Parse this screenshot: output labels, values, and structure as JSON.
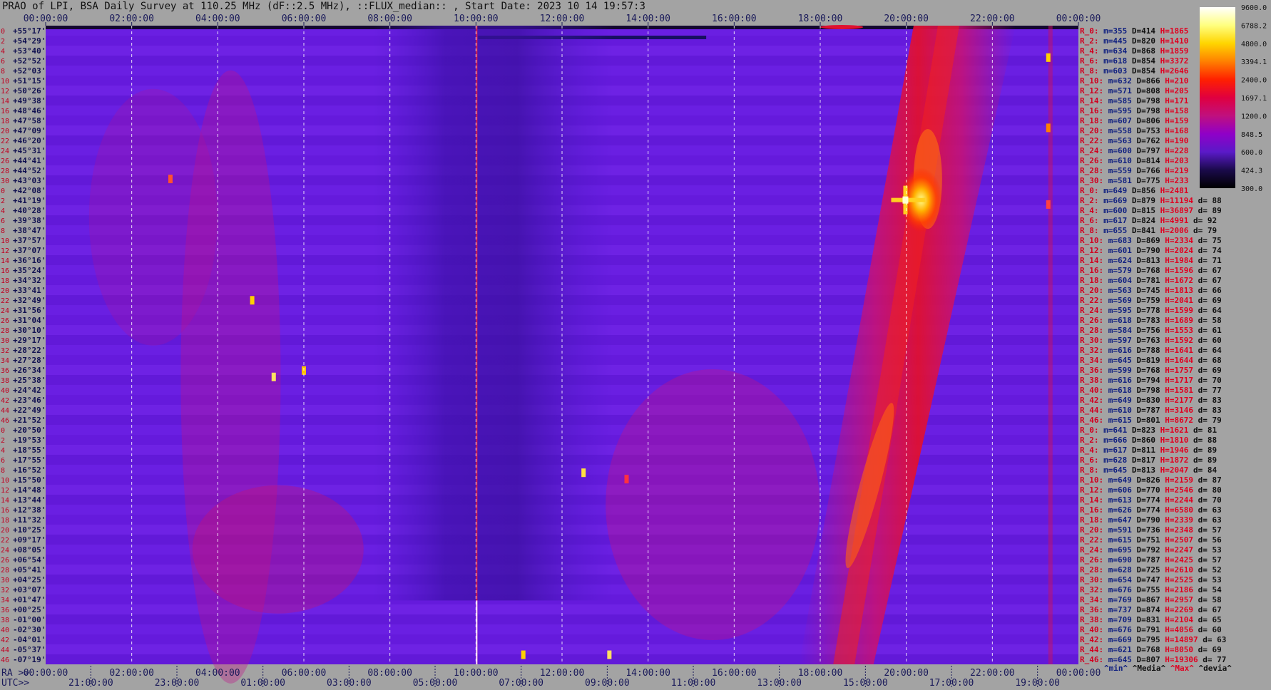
{
  "title": "PRAO of LPI, BSA Daily Survey at 110.25 MHz (dF::2.5 MHz), ::FLUX_median:: , Start Date: 2023 10 14 19:57:3",
  "chart_data": {
    "type": "heatmap",
    "top_time_ticks": [
      "00:00:00",
      "02:00:00",
      "04:00:00",
      "06:00:00",
      "08:00:00",
      "10:00:00",
      "12:00:00",
      "14:00:00",
      "16:00:00",
      "18:00:00",
      "20:00:00",
      "22:00:00",
      "00:00:00"
    ],
    "bottom_ra_ticks": [
      "00:00:00",
      "02:00:00",
      "04:00:00",
      "06:00:00",
      "08:00:00",
      "10:00:00",
      "12:00:00",
      "14:00:00",
      "16:00:00",
      "18:00:00",
      "20:00:00",
      "22:00:00",
      "00:00:00"
    ],
    "bottom_utc_ticks": [
      "21:00:00",
      "23:00:00",
      "01:00:00",
      "03:00:00",
      "05:00:00",
      "07:00:00",
      "09:00:00",
      "11:00:00",
      "13:00:00",
      "15:00:00",
      "17:00:00",
      "19:00:00"
    ],
    "bottom_ra_prefix": "RA >>",
    "bottom_utc_prefix": "UTC>>",
    "declinations": [
      "+55°17'",
      "+54°29'",
      "+53°40'",
      "+52°52'",
      "+52°03'",
      "+51°15'",
      "+50°26'",
      "+49°38'",
      "+48°46'",
      "+47°58'",
      "+47°09'",
      "+46°20'",
      "+45°31'",
      "+44°41'",
      "+44°52'",
      "+43°03'",
      "+42°08'",
      "+41°19'",
      "+40°28'",
      "+39°38'",
      "+38°47'",
      "+37°57'",
      "+37°07'",
      "+36°16'",
      "+35°24'",
      "+34°32'",
      "+33°41'",
      "+32°49'",
      "+31°56'",
      "+31°04'",
      "+30°10'",
      "+29°17'",
      "+28°22'",
      "+27°28'",
      "+26°34'",
      "+25°38'",
      "+24°42'",
      "+23°46'",
      "+22°49'",
      "+21°52'",
      "+20°50'",
      "+19°53'",
      "+18°55'",
      "+17°55'",
      "+16°52'",
      "+15°50'",
      "+14°48'",
      "+13°44'",
      "+12°38'",
      "+11°32'",
      "+10°25'",
      "+09°17'",
      "+08°05'",
      "+06°54'",
      "+05°41'",
      "+04°25'",
      "+03°07'",
      "+01°47'",
      "+00°25'",
      "-01°00'",
      "-02°30'",
      "-04°01'",
      "-05°37'",
      "-07°19'"
    ],
    "row_numbers": [
      "0",
      "2",
      "4",
      "6",
      "8",
      "10",
      "12",
      "14",
      "16",
      "18",
      "20",
      "22",
      "24",
      "26",
      "28",
      "30",
      "0",
      "2",
      "4",
      "6",
      "8",
      "10",
      "12",
      "14",
      "16",
      "18",
      "20",
      "22",
      "24",
      "26",
      "28",
      "30",
      "32",
      "34",
      "36",
      "38",
      "40",
      "42",
      "44",
      "46",
      "0",
      "2",
      "4",
      "6",
      "8",
      "10",
      "12",
      "14",
      "16",
      "18",
      "20",
      "22",
      "24",
      "26",
      "28",
      "30",
      "32",
      "34",
      "36",
      "38",
      "40",
      "42",
      "44",
      "46"
    ],
    "stats": [
      {
        "r": "R_0:",
        "m": "m=355",
        "d": "D=414",
        "h": "H=1865",
        "dv": ""
      },
      {
        "r": "R_2:",
        "m": "m=445",
        "d": "D=820",
        "h": "H=1410",
        "dv": ""
      },
      {
        "r": "R_4:",
        "m": "m=634",
        "d": "D=868",
        "h": "H=1859",
        "dv": ""
      },
      {
        "r": "R_6:",
        "m": "m=618",
        "d": "D=854",
        "h": "H=3372",
        "dv": ""
      },
      {
        "r": "R_8:",
        "m": "m=603",
        "d": "D=854",
        "h": "H=2646",
        "dv": ""
      },
      {
        "r": "R_10:",
        "m": "m=632",
        "d": "D=866",
        "h": "H=210",
        "dv": ""
      },
      {
        "r": "R_12:",
        "m": "m=571",
        "d": "D=808",
        "h": "H=205",
        "dv": ""
      },
      {
        "r": "R_14:",
        "m": "m=585",
        "d": "D=798",
        "h": "H=171",
        "dv": ""
      },
      {
        "r": "R_16:",
        "m": "m=595",
        "d": "D=798",
        "h": "H=158",
        "dv": ""
      },
      {
        "r": "R_18:",
        "m": "m=607",
        "d": "D=806",
        "h": "H=159",
        "dv": ""
      },
      {
        "r": "R_20:",
        "m": "m=558",
        "d": "D=753",
        "h": "H=168",
        "dv": ""
      },
      {
        "r": "R_22:",
        "m": "m=563",
        "d": "D=762",
        "h": "H=190",
        "dv": ""
      },
      {
        "r": "R_24:",
        "m": "m=600",
        "d": "D=797",
        "h": "H=228",
        "dv": ""
      },
      {
        "r": "R_26:",
        "m": "m=610",
        "d": "D=814",
        "h": "H=203",
        "dv": ""
      },
      {
        "r": "R_28:",
        "m": "m=559",
        "d": "D=766",
        "h": "H=219",
        "dv": ""
      },
      {
        "r": "R_30:",
        "m": "m=581",
        "d": "D=775",
        "h": "H=233",
        "dv": ""
      },
      {
        "r": "R_0:",
        "m": "m=649",
        "d": "D=856",
        "h": "H=2481",
        "dv": ""
      },
      {
        "r": "R_2:",
        "m": "m=669",
        "d": "D=879",
        "h": "H=11194",
        "dv": "d= 88"
      },
      {
        "r": "R_4:",
        "m": "m=600",
        "d": "D=815",
        "h": "H=36897",
        "dv": "d= 89"
      },
      {
        "r": "R_6:",
        "m": "m=617",
        "d": "D=824",
        "h": "H=4991",
        "dv": "d= 92"
      },
      {
        "r": "R_8:",
        "m": "m=655",
        "d": "D=841",
        "h": "H=2006",
        "dv": "d= 79"
      },
      {
        "r": "R_10:",
        "m": "m=683",
        "d": "D=869",
        "h": "H=2334",
        "dv": "d= 75"
      },
      {
        "r": "R_12:",
        "m": "m=601",
        "d": "D=790",
        "h": "H=2024",
        "dv": "d= 74"
      },
      {
        "r": "R_14:",
        "m": "m=624",
        "d": "D=813",
        "h": "H=1984",
        "dv": "d= 71"
      },
      {
        "r": "R_16:",
        "m": "m=579",
        "d": "D=768",
        "h": "H=1596",
        "dv": "d= 67"
      },
      {
        "r": "R_18:",
        "m": "m=604",
        "d": "D=781",
        "h": "H=1672",
        "dv": "d= 67"
      },
      {
        "r": "R_20:",
        "m": "m=563",
        "d": "D=745",
        "h": "H=1813",
        "dv": "d= 66"
      },
      {
        "r": "R_22:",
        "m": "m=569",
        "d": "D=759",
        "h": "H=2041",
        "dv": "d= 69"
      },
      {
        "r": "R_24:",
        "m": "m=595",
        "d": "D=778",
        "h": "H=1599",
        "dv": "d= 64"
      },
      {
        "r": "R_26:",
        "m": "m=618",
        "d": "D=783",
        "h": "H=1689",
        "dv": "d= 58"
      },
      {
        "r": "R_28:",
        "m": "m=584",
        "d": "D=756",
        "h": "H=1553",
        "dv": "d= 61"
      },
      {
        "r": "R_30:",
        "m": "m=597",
        "d": "D=763",
        "h": "H=1592",
        "dv": "d= 60"
      },
      {
        "r": "R_32:",
        "m": "m=616",
        "d": "D=788",
        "h": "H=1641",
        "dv": "d= 64"
      },
      {
        "r": "R_34:",
        "m": "m=645",
        "d": "D=819",
        "h": "H=1644",
        "dv": "d= 68"
      },
      {
        "r": "R_36:",
        "m": "m=599",
        "d": "D=768",
        "h": "H=1757",
        "dv": "d= 69"
      },
      {
        "r": "R_38:",
        "m": "m=616",
        "d": "D=794",
        "h": "H=1717",
        "dv": "d= 70"
      },
      {
        "r": "R_40:",
        "m": "m=618",
        "d": "D=798",
        "h": "H=1581",
        "dv": "d= 77"
      },
      {
        "r": "R_42:",
        "m": "m=649",
        "d": "D=830",
        "h": "H=2177",
        "dv": "d= 83"
      },
      {
        "r": "R_44:",
        "m": "m=610",
        "d": "D=787",
        "h": "H=3146",
        "dv": "d= 83"
      },
      {
        "r": "R_46:",
        "m": "m=615",
        "d": "D=801",
        "h": "H=8672",
        "dv": "d= 79"
      },
      {
        "r": "R_0:",
        "m": "m=641",
        "d": "D=823",
        "h": "H=1621",
        "dv": "d= 81"
      },
      {
        "r": "R_2:",
        "m": "m=666",
        "d": "D=860",
        "h": "H=1810",
        "dv": "d= 88"
      },
      {
        "r": "R_4:",
        "m": "m=617",
        "d": "D=811",
        "h": "H=1946",
        "dv": "d= 89"
      },
      {
        "r": "R_6:",
        "m": "m=628",
        "d": "D=817",
        "h": "H=1872",
        "dv": "d= 89"
      },
      {
        "r": "R_8:",
        "m": "m=645",
        "d": "D=813",
        "h": "H=2047",
        "dv": "d= 84"
      },
      {
        "r": "R_10:",
        "m": "m=649",
        "d": "D=826",
        "h": "H=2159",
        "dv": "d= 87"
      },
      {
        "r": "R_12:",
        "m": "m=606",
        "d": "D=770",
        "h": "H=2546",
        "dv": "d= 80"
      },
      {
        "r": "R_14:",
        "m": "m=613",
        "d": "D=774",
        "h": "H=2244",
        "dv": "d= 70"
      },
      {
        "r": "R_16:",
        "m": "m=626",
        "d": "D=774",
        "h": "H=6580",
        "dv": "d= 63"
      },
      {
        "r": "R_18:",
        "m": "m=647",
        "d": "D=790",
        "h": "H=2339",
        "dv": "d= 63"
      },
      {
        "r": "R_20:",
        "m": "m=591",
        "d": "D=736",
        "h": "H=2348",
        "dv": "d= 57"
      },
      {
        "r": "R_22:",
        "m": "m=615",
        "d": "D=751",
        "h": "H=2507",
        "dv": "d= 56"
      },
      {
        "r": "R_24:",
        "m": "m=695",
        "d": "D=792",
        "h": "H=2247",
        "dv": "d= 53"
      },
      {
        "r": "R_26:",
        "m": "m=690",
        "d": "D=787",
        "h": "H=2425",
        "dv": "d= 57"
      },
      {
        "r": "R_28:",
        "m": "m=628",
        "d": "D=725",
        "h": "H=2610",
        "dv": "d= 52"
      },
      {
        "r": "R_30:",
        "m": "m=654",
        "d": "D=747",
        "h": "H=2525",
        "dv": "d= 53"
      },
      {
        "r": "R_32:",
        "m": "m=676",
        "d": "D=755",
        "h": "H=2186",
        "dv": "d= 54"
      },
      {
        "r": "R_34:",
        "m": "m=769",
        "d": "D=867",
        "h": "H=2957",
        "dv": "d= 58"
      },
      {
        "r": "R_36:",
        "m": "m=737",
        "d": "D=874",
        "h": "H=2269",
        "dv": "d= 67"
      },
      {
        "r": "R_38:",
        "m": "m=709",
        "d": "D=831",
        "h": "H=2104",
        "dv": "d= 65"
      },
      {
        "r": "R_40:",
        "m": "m=676",
        "d": "D=791",
        "h": "H=4056",
        "dv": "d= 60"
      },
      {
        "r": "R_42:",
        "m": "m=669",
        "d": "D=795",
        "h": "H=14897",
        "dv": "d= 63"
      },
      {
        "r": "R_44:",
        "m": "m=621",
        "d": "D=768",
        "h": "H=8050",
        "dv": "d= 69"
      },
      {
        "r": "R_46:",
        "m": "m=645",
        "d": "D=807",
        "h": "H=19306",
        "dv": "d= 77"
      }
    ],
    "stats_legend": {
      "min": "^min^",
      "median": "^Media^",
      "max": "^Max^",
      "devia": "^devia^"
    },
    "colorbar": {
      "ticks": [
        "9600.0",
        "6788.2",
        "4800.0",
        "3394.1",
        "2400.0",
        "1697.1",
        "1200.0",
        "848.5",
        "600.0",
        "424.3",
        "300.0"
      ],
      "colors": [
        "#ffffff",
        "#ffff80",
        "#ffd500",
        "#ff8000",
        "#ff2000",
        "#e00040",
        "#c0107e",
        "#9000c8",
        "#5a1ac8",
        "#1a0a4a",
        "#000000"
      ]
    },
    "features": [
      {
        "type": "band",
        "name": "galactic-plane",
        "ra_start": "18:30",
        "ra_end": "20:45",
        "dec_top": "+55°17'",
        "dec_bottom": "-07°19'"
      },
      {
        "type": "source",
        "name": "bright-source",
        "ra": "19:59",
        "dec": "+40°28'",
        "flux_level": "max"
      }
    ]
  }
}
